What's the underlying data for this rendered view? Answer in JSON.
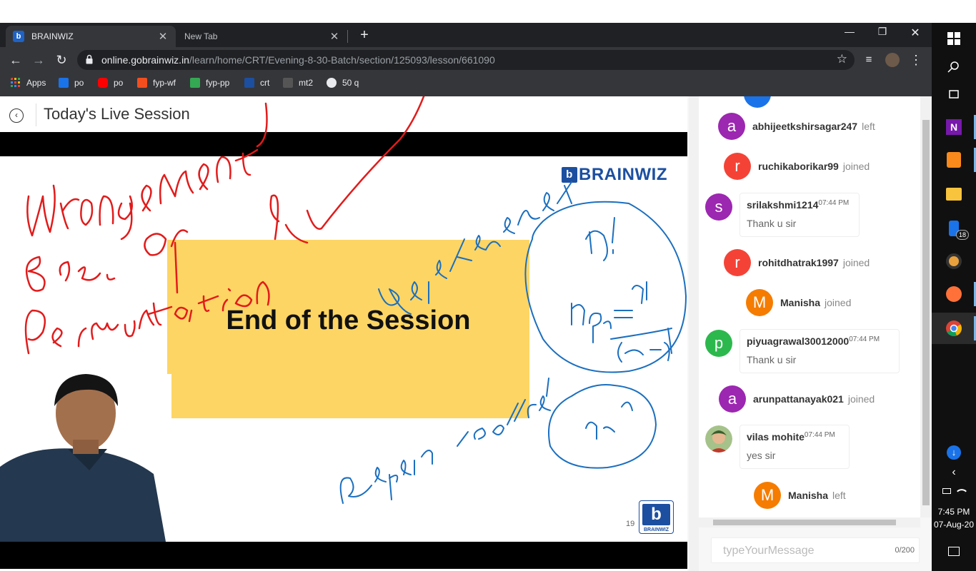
{
  "browser": {
    "tabs": [
      {
        "label": "BRAINWIZ",
        "favicon": "b",
        "active": true
      },
      {
        "label": "New Tab",
        "active": false
      }
    ],
    "new_tab_symbol": "+",
    "url_host": "online.gobrainwiz.in",
    "url_path": "/learn/home/CRT/Evening-8-30-Batch/section/125093/lesson/661090",
    "bookmarks": [
      {
        "label": "Apps",
        "icon": "apps-grid-icon",
        "color": "#ea4335"
      },
      {
        "label": "po",
        "icon": "e-icon",
        "color": "#1a73e8"
      },
      {
        "label": "po",
        "icon": "youtube-icon",
        "color": "#ff0000"
      },
      {
        "label": "fyp-wf",
        "icon": "figma-icon",
        "color": "#f24e1e"
      },
      {
        "label": "fyp-pp",
        "icon": "chart-icon",
        "color": "#34a853"
      },
      {
        "label": "crt",
        "icon": "brainwiz-icon",
        "color": "#1c4fa0"
      },
      {
        "label": "mt2",
        "icon": "cc-icon",
        "color": "#555555"
      },
      {
        "label": "50 q",
        "icon": "globe-icon",
        "color": "#e8eaed"
      }
    ]
  },
  "page": {
    "title": "Today's Live Session"
  },
  "slide": {
    "brand": "BRAINWIZ",
    "brand_letter": "b",
    "heading": "End of the Session",
    "number": "19",
    "corner_logo_caption": "BRAINWIZ"
  },
  "chat": {
    "events": [
      {
        "type": "event",
        "user": "abhijeetkshirsagar247",
        "action": "left",
        "initial": "a",
        "color": "#9c27b0"
      },
      {
        "type": "event",
        "user": "ruchikaborikar99",
        "action": "joined",
        "initial": "r",
        "color": "#f44336"
      },
      {
        "type": "message",
        "user": "srilakshmi1214",
        "time": "07:44 PM",
        "text": "Thank u sir",
        "initial": "s",
        "color": "#9c27b0"
      },
      {
        "type": "event",
        "user": "rohitdhatrak1997",
        "action": "joined",
        "initial": "r",
        "color": "#f44336"
      },
      {
        "type": "event",
        "user": "Manisha",
        "action": "joined",
        "initial": "M",
        "color": "#f57c00"
      },
      {
        "type": "message",
        "user": "piyuagrawal30012000",
        "time": "07:44 PM",
        "text": "Thank u sir",
        "initial": "p",
        "color": "#2db84d"
      },
      {
        "type": "event",
        "user": "arunpattanayak021",
        "action": "joined",
        "initial": "a",
        "color": "#9c27b0"
      },
      {
        "type": "message",
        "user": "vilas mohite",
        "time": "07:44 PM",
        "text": "yes sir",
        "initial": "",
        "color": "#a5c28a"
      },
      {
        "type": "event",
        "user": "Manisha",
        "action": "left",
        "initial": "M",
        "color": "#f57c00"
      }
    ],
    "input_placeholder": "typeYourMessage",
    "char_count": "0/200"
  },
  "taskbar": {
    "badge_count": "18",
    "time": "7:45 PM",
    "date": "07-Aug-20"
  }
}
